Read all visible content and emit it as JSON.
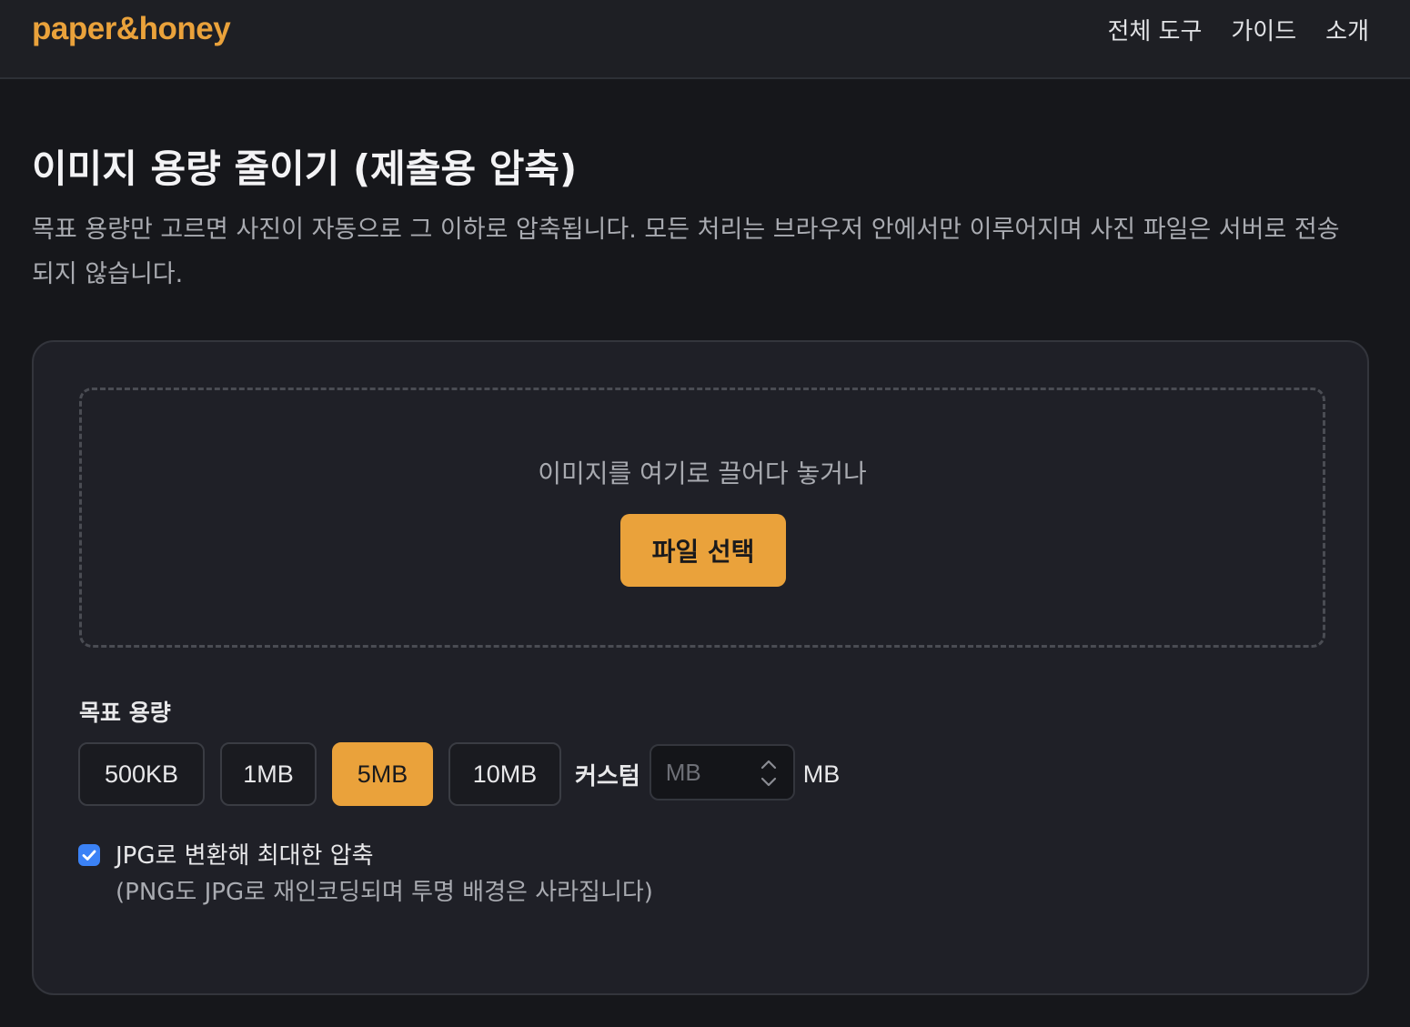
{
  "header": {
    "logo": "paper&honey",
    "nav": [
      "전체 도구",
      "가이드",
      "소개"
    ]
  },
  "page": {
    "title": "이미지 용량 줄이기 (제출용 압축)",
    "description": "목표 용량만 고르면 사진이 자동으로 그 이하로 압축됩니다. 모든 처리는 브라우저 안에서만 이루어지며 사진 파일은 서버로 전송되지 않습니다."
  },
  "upload": {
    "drop_text": "이미지를 여기로 끌어다 놓거나",
    "button_label": "파일 선택"
  },
  "target": {
    "label": "목표 용량",
    "options": [
      "500KB",
      "1MB",
      "5MB",
      "10MB"
    ],
    "selected": "5MB",
    "custom_label": "커스텀",
    "custom_placeholder": "MB",
    "custom_unit": "MB"
  },
  "jpg_option": {
    "checked": true,
    "label": "JPG로 변환해 최대한 압축",
    "hint": "(PNG도 JPG로 재인코딩되며 투명 배경은 사라집니다)"
  },
  "colors": {
    "accent": "#eaa23b",
    "checkbox": "#3b82f6",
    "background": "#16171b",
    "card": "#1f2027"
  }
}
